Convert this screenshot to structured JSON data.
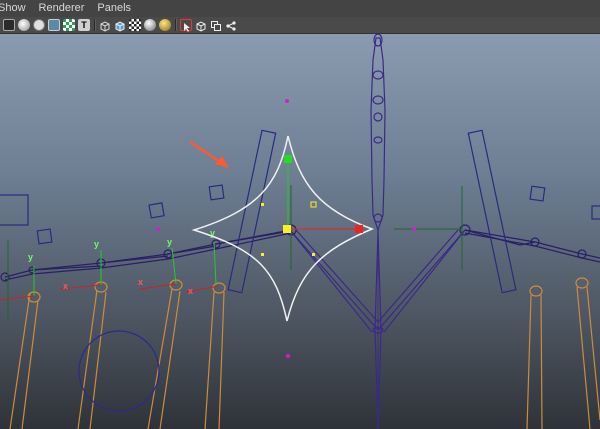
{
  "menu": {
    "items": [
      "Show",
      "Renderer",
      "Panels"
    ]
  },
  "toolbar": {
    "buttons": [
      {
        "name": "shading-wireframe-button",
        "icon": "wire-sphere-icon"
      },
      {
        "name": "shading-smooth-button",
        "icon": "smooth-sphere-icon"
      },
      {
        "name": "shading-flat-button",
        "icon": "flat-sphere-icon"
      },
      {
        "name": "bounding-box-button",
        "icon": "box-icon"
      },
      {
        "name": "texture-button",
        "icon": "checker-icon"
      },
      {
        "name": "text-label-button",
        "icon": "T-icon"
      },
      {
        "name": "wire-cube-button",
        "icon": "wire-cube-icon"
      },
      {
        "name": "shaded-cube-button",
        "icon": "shaded-cube-icon"
      },
      {
        "name": "checker-cube-button",
        "icon": "checker-cube-icon"
      },
      {
        "name": "lighting-button",
        "icon": "sphere-light-icon"
      },
      {
        "name": "material-button",
        "icon": "gold-sphere-icon"
      },
      {
        "name": "select-tool-button",
        "icon": "select-arrow-icon"
      },
      {
        "name": "object-mode-button",
        "icon": "cube-outline-icon"
      },
      {
        "name": "component-mode-button",
        "icon": "copy-icon"
      },
      {
        "name": "share-button",
        "icon": "node-share-icon"
      }
    ],
    "t_label": "T"
  },
  "colors": {
    "viewport_top": "#8a9bb0",
    "viewport_bottom": "#2f3339",
    "joint": "#2a1f66",
    "bone": "#3a2a88",
    "control": "#2a2a80",
    "leg": "#d08a3a",
    "arrow": "#ff5a2a",
    "handle_green": "#22cc22",
    "handle_red": "#ee2222",
    "pivot": "#cc22cc"
  },
  "axis_labels": {
    "y": "y",
    "x": "x"
  }
}
